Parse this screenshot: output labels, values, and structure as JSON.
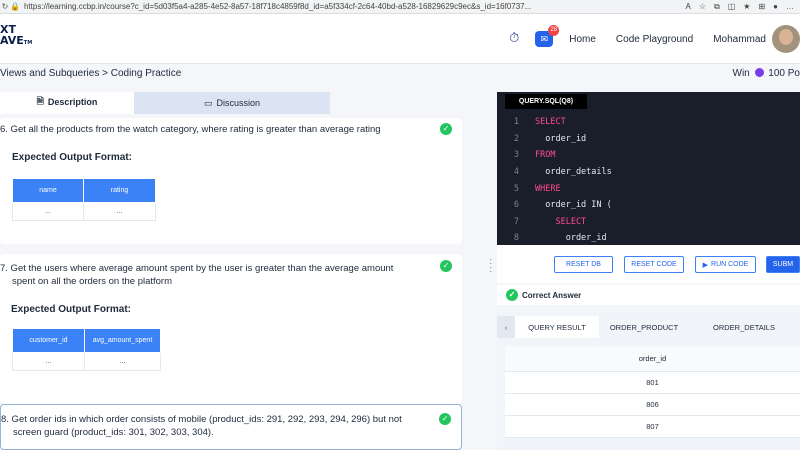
{
  "browser": {
    "url": "https://learning.ccbp.in/course?c_id=5d03f5a4-a285-4e52-8a57-18f718c4859f8d_id=a5f334cf-2c64-40bd-a528-16829629c9ec&s_id=16f0737..."
  },
  "header": {
    "logo_line1": "XT",
    "logo_line2": "AVE",
    "logo_tm": "TM",
    "chat_badge": "28",
    "nav_home": "Home",
    "nav_playground": "Code Playground",
    "user_name": "Mohammad"
  },
  "breadcrumb": {
    "text": "Views and Subqueries > Coding Practice",
    "win_label": "Win",
    "win_points": "100 Po"
  },
  "tabs": {
    "description": "Description",
    "discussion": "Discussion"
  },
  "questions": {
    "q6": {
      "text": "6.  Get all the products from the watch category, where rating is greater than average rating",
      "expected": "Expected Output Format:",
      "columns": [
        "name",
        "rating"
      ],
      "row": [
        "...",
        "..."
      ]
    },
    "q7": {
      "text_line1": "7.  Get the  users where average amount spent by the user is greater than the average amount",
      "text_line2": "spent on all the orders on the platform",
      "expected": "Expected Output Format:",
      "columns": [
        "customer_id",
        "avg_amount_spent"
      ],
      "row": [
        "...",
        "..."
      ]
    },
    "q8": {
      "text_line1": "8.  Get order ids in which order consists of mobile (product_ids: 291, 292, 293, 294, 296) but not",
      "text_line2": "screen guard (product_ids: 301, 302, 303, 304)."
    }
  },
  "editor": {
    "tab": "QUERY.SQL(Q8)",
    "lines": [
      {
        "n": "1",
        "kw": "SELECT",
        "id": ""
      },
      {
        "n": "2",
        "kw": "",
        "id": "  order_id"
      },
      {
        "n": "3",
        "kw": "FROM",
        "id": ""
      },
      {
        "n": "4",
        "kw": "",
        "id": "  order_details"
      },
      {
        "n": "5",
        "kw": "WHERE",
        "id": ""
      },
      {
        "n": "6",
        "kw": "",
        "id": "  order_id IN ("
      },
      {
        "n": "7",
        "kw": "    SELECT",
        "id": ""
      },
      {
        "n": "8",
        "kw": "",
        "id": "      order_id"
      }
    ]
  },
  "toolbar": {
    "reset_db": "RESET DB",
    "reset_code": "RESET CODE",
    "run_code": "RUN CODE",
    "submit": "SUBM"
  },
  "status": {
    "correct": "Correct Answer"
  },
  "results": {
    "tabs": [
      "QUERY RESULT",
      "ORDER_PRODUCT",
      "ORDER_DETAILS"
    ],
    "column": "order_id",
    "rows": [
      "801",
      "806",
      "807"
    ]
  }
}
